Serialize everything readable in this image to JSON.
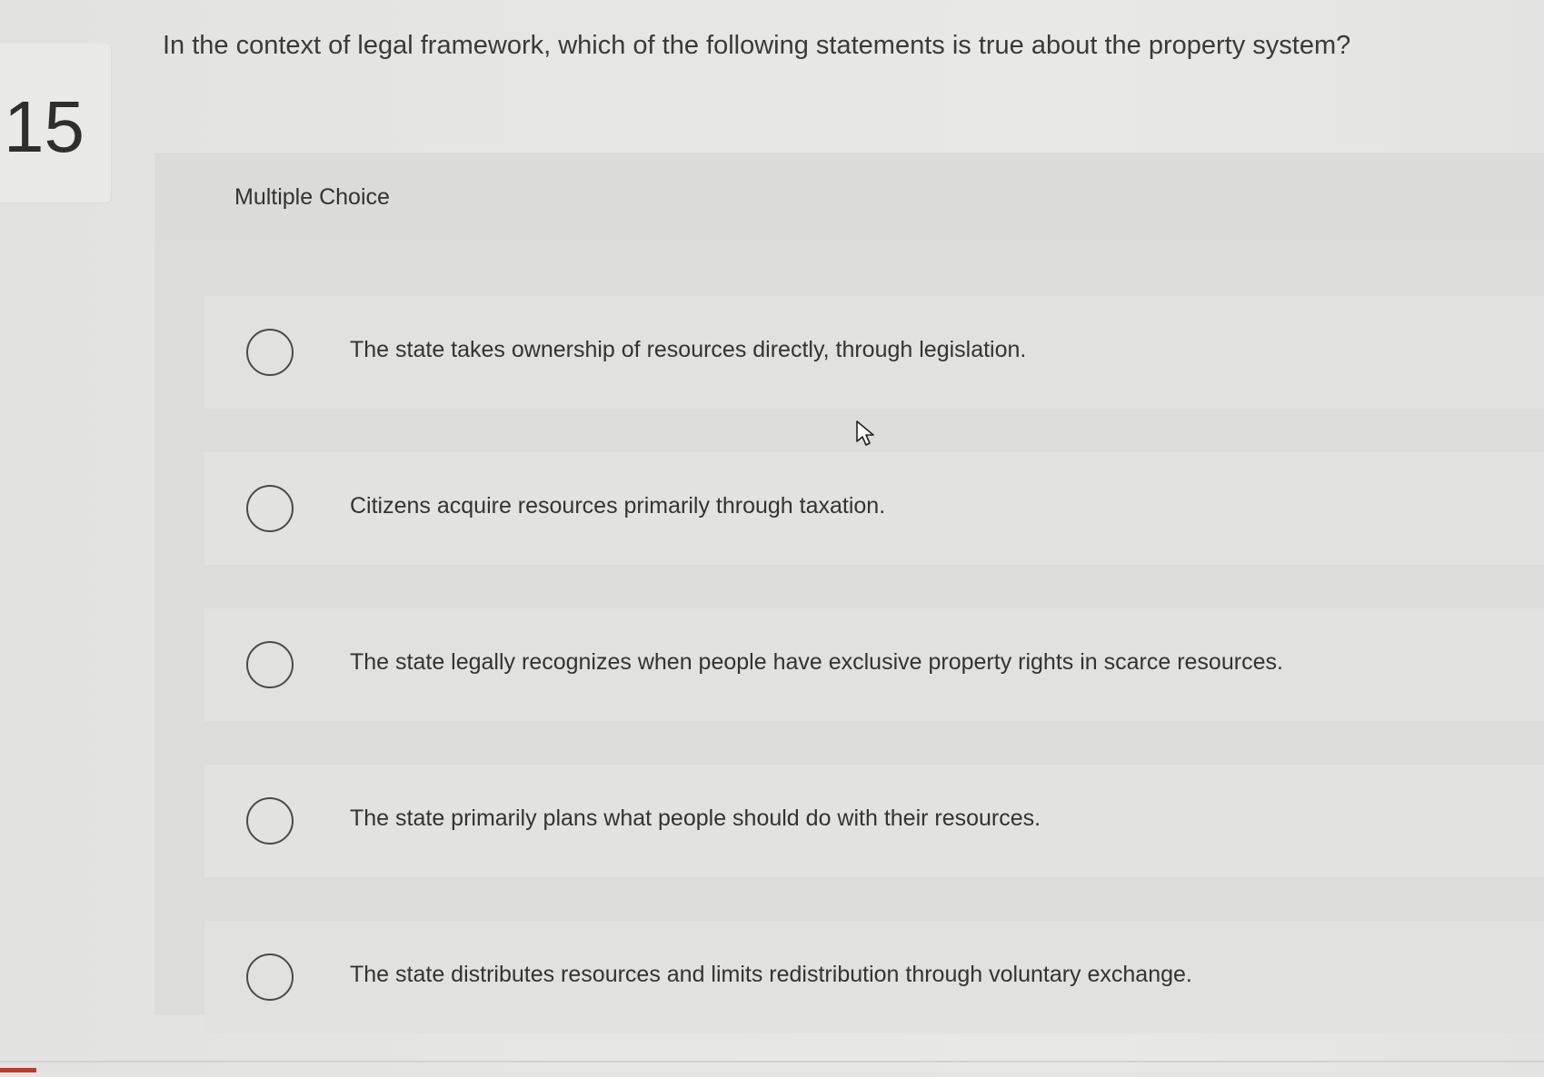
{
  "question": {
    "number": "15",
    "text": "In the context of legal framework, which of the following statements is true about the property system?"
  },
  "answer_section": {
    "type_label": "Multiple Choice",
    "options": [
      {
        "label": "The state takes ownership of resources directly, through legislation.",
        "selected": false
      },
      {
        "label": "Citizens acquire resources primarily through taxation.",
        "selected": false
      },
      {
        "label": "The state legally recognizes when people have exclusive property rights in scarce resources.",
        "selected": false
      },
      {
        "label": "The state primarily plans what people should do with their resources.",
        "selected": false
      },
      {
        "label": "The state distributes resources and limits redistribution through voluntary exchange.",
        "selected": false
      }
    ]
  },
  "icons": {
    "cursor": "mouse-pointer-icon",
    "radio": "radio-button-icon"
  },
  "colors": {
    "accent": "#c0392b",
    "text": "#333333",
    "background": "#e4e4e2"
  }
}
